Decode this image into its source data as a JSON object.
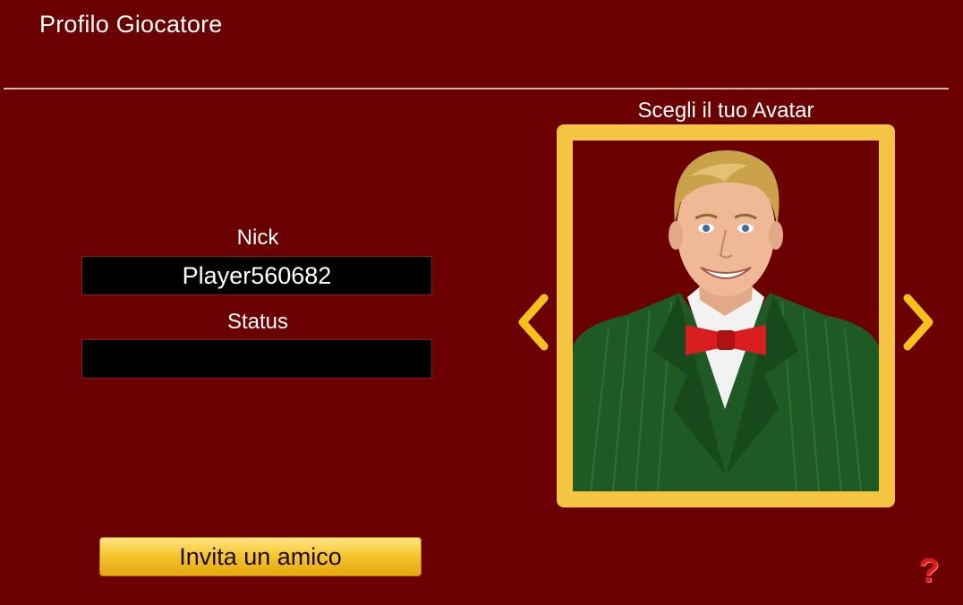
{
  "header": {
    "title": "Profilo Giocatore"
  },
  "form": {
    "nick_label": "Nick",
    "nick_value": "Player560682",
    "status_label": "Status",
    "status_value": ""
  },
  "avatar": {
    "label": "Scegli il tuo Avatar",
    "prev_icon": "chevron-left-icon",
    "next_icon": "chevron-right-icon",
    "frame_color": "#f5c542"
  },
  "actions": {
    "invite_label": "Invita un amico",
    "help_icon": "question-mark-icon",
    "help_symbol": "?"
  },
  "colors": {
    "background": "#6b0000",
    "accent": "#f5c542",
    "help": "#e01818"
  }
}
